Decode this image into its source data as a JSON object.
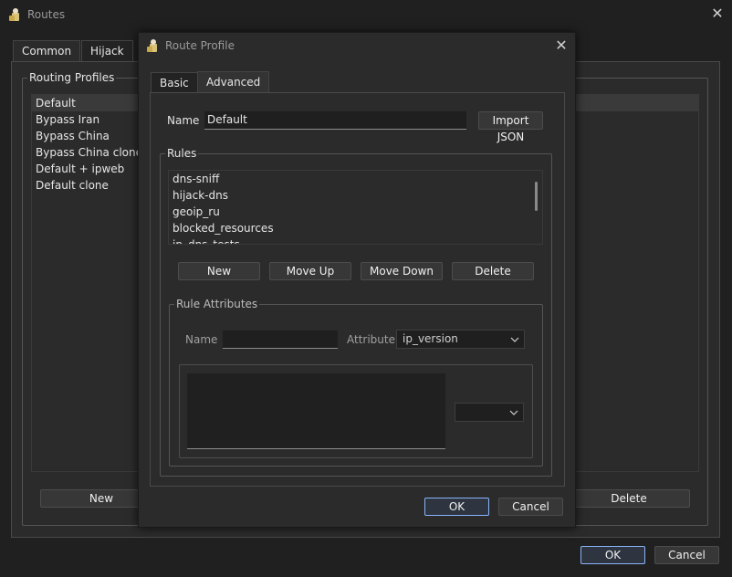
{
  "window": {
    "title": "Routes",
    "tabs": [
      "Common",
      "Hijack"
    ]
  },
  "routing_profiles": {
    "group_title": "Routing Profiles",
    "items": [
      "Default",
      "Bypass Iran",
      "Bypass China",
      "Bypass China clone",
      "Default + ipweb",
      "Default clone"
    ],
    "selected_index": 0,
    "new_label": "New",
    "delete_label": "Delete"
  },
  "footer": {
    "ok_label": "OK",
    "cancel_label": "Cancel"
  },
  "dialog": {
    "title": "Route Profile",
    "tabs": [
      "Basic",
      "Advanced"
    ],
    "active_tab": "Advanced",
    "name_label": "Name",
    "name_value": "Default",
    "import_json_label": "Import JSON",
    "rules": {
      "group_title": "Rules",
      "items": [
        "dns-sniff",
        "hijack-dns",
        "geoip_ru",
        "blocked_resources",
        "ip_dns_tests"
      ],
      "new_label": "New",
      "move_up_label": "Move Up",
      "move_down_label": "Move Down",
      "delete_label": "Delete"
    },
    "rule_attributes": {
      "group_title": "Rule Attributes",
      "name_label": "Name",
      "name_value": "",
      "attribute_label": "Attribute",
      "attribute_value": "ip_version",
      "secondary_select_value": ""
    },
    "ok_label": "OK",
    "cancel_label": "Cancel"
  },
  "colors": {
    "background": "#202020",
    "panel": "#2b2b2b",
    "focus_border": "#8ab4f8"
  }
}
